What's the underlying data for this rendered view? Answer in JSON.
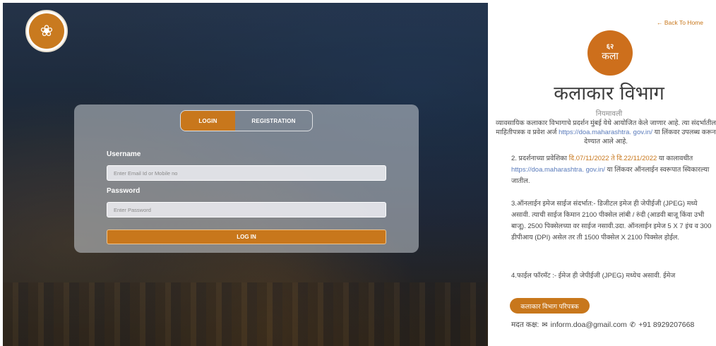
{
  "login": {
    "tabs": {
      "login": "LOGIN",
      "registration": "REGISTRATION"
    },
    "username_label": "Username",
    "username_placeholder": "Enter Email Id or Mobile no",
    "password_label": "Password",
    "password_placeholder": "Enter Password",
    "submit_label": "LOG IN"
  },
  "right": {
    "back_link": "← Back To Home",
    "logo_number": "६२",
    "logo_text": "कला",
    "title": "कलाकार विभाग",
    "subtitle": "नियमावली",
    "intro_1": "व्यावसायिक कलाकार विभागाचे प्रदर्शन मुंबई येथे आयोजित केले जाणार आहे. त्या संदर्भातील माहितीपत्रक व प्रवेश अर्ज ",
    "intro_link": "https://doa.maharashtra. gov.in/",
    "intro_2": " या लिंकवर उपलब्ध करून देण्यात आले आहे.",
    "p2_a": "2. प्रदर्शनाच्या प्रवेशिका ",
    "p2_dates": "दि.07/11/2022 ते दि.22/11/2022",
    "p2_b": " या कालावधीत ",
    "p2_link": "https://doa.maharashtra. gov.in/",
    "p2_c": " या लिंकवर ऑनलाईन स्वरूपात स्विकारल्या जातील.",
    "p3": "3.ऑनलाईन इमेज साईज संदर्भात:- डिजीटल इमेज ही जेपीईजी (JPEG) मध्ये असावी. त्याची साईज किमान 2100 पीक्सेल लांबी / रुंदी (आडवी बाजू किंवा उभी बाजू). 2500 पिक्सेलच्या वर साईज नसावी.उदा. ऑनलाईन इमेज 5 X 7 इंच व 300 डीपीआय (DPI) असेल तर ती 1500 पीक्सेल X 2100 पिक्सेल होईल.",
    "p4": "4.फाईल फॉरमॅट :- ईमेज ही जेपीईजी (JPEG) मध्येच असावी. ईमेज",
    "brochure_button": "कलाकार विभाग परिपत्रक",
    "contact_label": "मदत कक्ष:",
    "email": "inform.doa@gmail.com",
    "phone": "+91 8929207668"
  }
}
